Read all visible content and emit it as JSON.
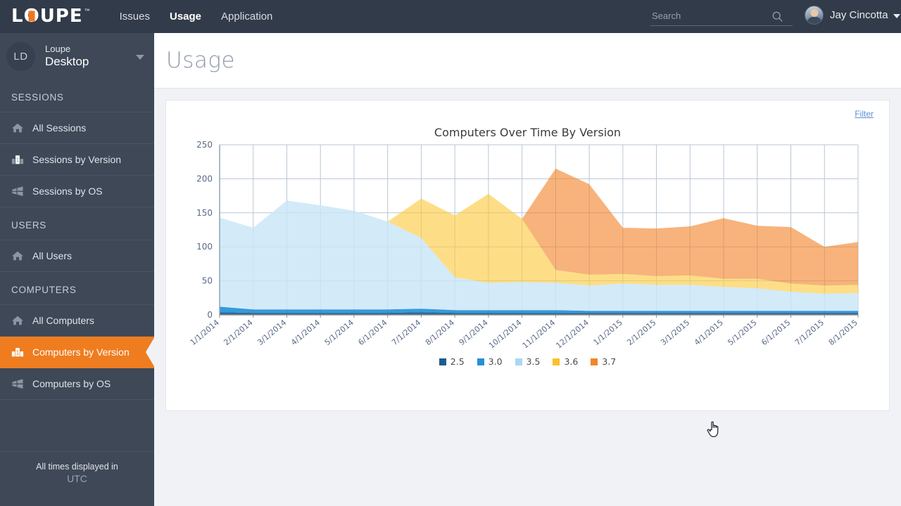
{
  "topbar": {
    "logo_text": "LOUPE",
    "logo_tm": "™",
    "nav": [
      {
        "label": "Issues",
        "active": false
      },
      {
        "label": "Usage",
        "active": true
      },
      {
        "label": "Application",
        "active": false
      }
    ],
    "search": {
      "placeholder": "Search",
      "value": ""
    },
    "user": {
      "name": "Jay Cincotta"
    }
  },
  "sidebar": {
    "org": {
      "badge": "LD",
      "line1": "Loupe",
      "line2": "Desktop"
    },
    "sections": [
      {
        "title": "SESSIONS",
        "items": [
          {
            "label": "All Sessions",
            "icon": "home-icon",
            "selected": false
          },
          {
            "label": "Sessions by Version",
            "icon": "version-icon",
            "selected": false
          },
          {
            "label": "Sessions by OS",
            "icon": "os-icon",
            "selected": false
          }
        ]
      },
      {
        "title": "USERS",
        "items": [
          {
            "label": "All Users",
            "icon": "home-icon",
            "selected": false
          }
        ]
      },
      {
        "title": "COMPUTERS",
        "items": [
          {
            "label": "All Computers",
            "icon": "home-icon",
            "selected": false
          },
          {
            "label": "Computers by Version",
            "icon": "version-icon",
            "selected": true
          },
          {
            "label": "Computers by OS",
            "icon": "os-icon",
            "selected": false
          }
        ]
      }
    ],
    "timezone_note": "All times displayed in",
    "timezone_value": "UTC"
  },
  "page": {
    "title": "Usage"
  },
  "card": {
    "filter_label": "Filter"
  },
  "chart_data": {
    "type": "area",
    "stacked": true,
    "title": "Computers Over Time By Version",
    "xlabel": "",
    "ylabel": "",
    "ylim": [
      0,
      250
    ],
    "yticks": [
      0,
      50,
      100,
      150,
      200,
      250
    ],
    "grid": true,
    "legend_position": "bottom",
    "categories": [
      "1/1/2014",
      "2/1/2014",
      "3/1/2014",
      "4/1/2014",
      "5/1/2014",
      "6/1/2014",
      "7/1/2014",
      "8/1/2014",
      "9/1/2014",
      "10/1/2014",
      "11/1/2014",
      "12/1/2014",
      "1/1/2015",
      "2/1/2015",
      "3/1/2015",
      "4/1/2015",
      "5/1/2015",
      "6/1/2015",
      "7/1/2015",
      "8/1/2015"
    ],
    "series": [
      {
        "name": "2.5",
        "color": "#1b5c8f",
        "values": [
          4,
          3,
          3,
          3,
          3,
          3,
          4,
          3,
          3,
          3,
          3,
          3,
          3,
          3,
          3,
          3,
          3,
          3,
          3,
          3
        ]
      },
      {
        "name": "3.0",
        "color": "#2491d9",
        "values": [
          8,
          5,
          5,
          5,
          5,
          5,
          5,
          4,
          4,
          4,
          4,
          3,
          3,
          3,
          3,
          3,
          3,
          3,
          3,
          3
        ]
      },
      {
        "name": "3.5",
        "color": "#c9e5f8",
        "values": [
          131,
          120,
          160,
          153,
          145,
          129,
          104,
          48,
          40,
          41,
          40,
          37,
          40,
          38,
          38,
          35,
          33,
          28,
          25,
          26
        ]
      },
      {
        "name": "3.6",
        "color": "#fbc93d",
        "values": [
          0,
          0,
          0,
          0,
          0,
          0,
          58,
          91,
          131,
          93,
          19,
          16,
          14,
          13,
          14,
          12,
          14,
          12,
          12,
          12
        ]
      },
      {
        "name": "3.7",
        "color": "#f2852a",
        "values": [
          0,
          0,
          0,
          0,
          0,
          0,
          0,
          0,
          0,
          0,
          149,
          133,
          68,
          70,
          72,
          89,
          78,
          83,
          57,
          63
        ]
      }
    ],
    "legend": [
      {
        "label": "2.5",
        "color": "#1b5c8f"
      },
      {
        "label": "3.0",
        "color": "#2491d9"
      },
      {
        "label": "3.5",
        "color": "#a9d8f2"
      },
      {
        "label": "3.6",
        "color": "#fbc02d"
      },
      {
        "label": "3.7",
        "color": "#f2852a"
      }
    ]
  }
}
